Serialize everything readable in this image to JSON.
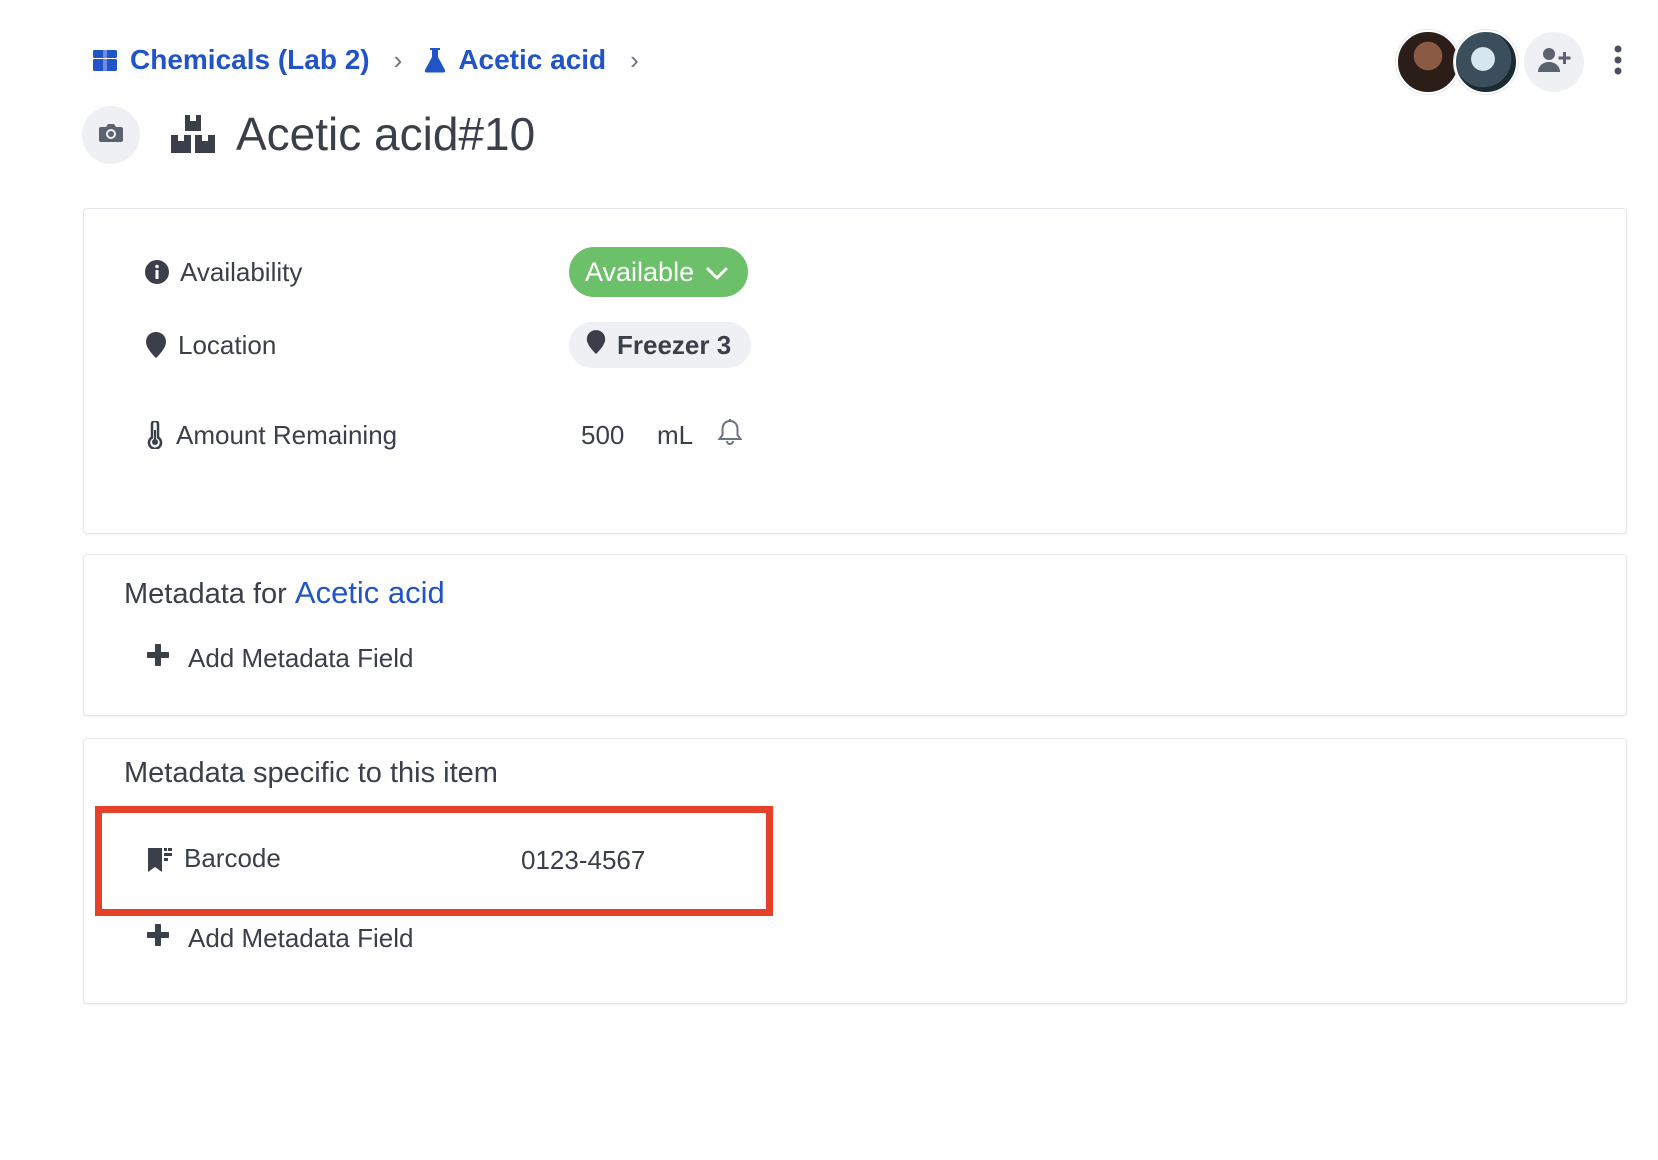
{
  "breadcrumb": {
    "items": [
      {
        "label": "Chemicals (Lab 2)",
        "icon": "box-icon"
      },
      {
        "label": "Acetic acid",
        "icon": "flask-icon"
      }
    ],
    "separator": "›"
  },
  "header": {
    "title": "Acetic acid#10",
    "title_icon": "boxes-icon"
  },
  "properties": {
    "availability": {
      "label": "Availability",
      "value": "Available",
      "icon": "info-circle-icon",
      "color": "#6cc06a"
    },
    "location": {
      "label": "Location",
      "value": "Freezer 3",
      "icon": "map-pin-icon"
    },
    "amount": {
      "label": "Amount Remaining",
      "value": "500",
      "unit": "mL",
      "icon": "thermometer-icon"
    }
  },
  "metadata_template": {
    "heading_prefix": "Metadata for",
    "heading_link": "Acetic acid",
    "add_label": "Add Metadata Field"
  },
  "metadata_item": {
    "heading": "Metadata specific to this item",
    "fields": [
      {
        "label": "Barcode",
        "value": "0123-4567",
        "icon": "barcode-bookmark-icon"
      }
    ],
    "add_label": "Add Metadata Field"
  },
  "colors": {
    "link": "#2054c8",
    "available": "#6cc06a",
    "highlight": "#e4402a"
  }
}
